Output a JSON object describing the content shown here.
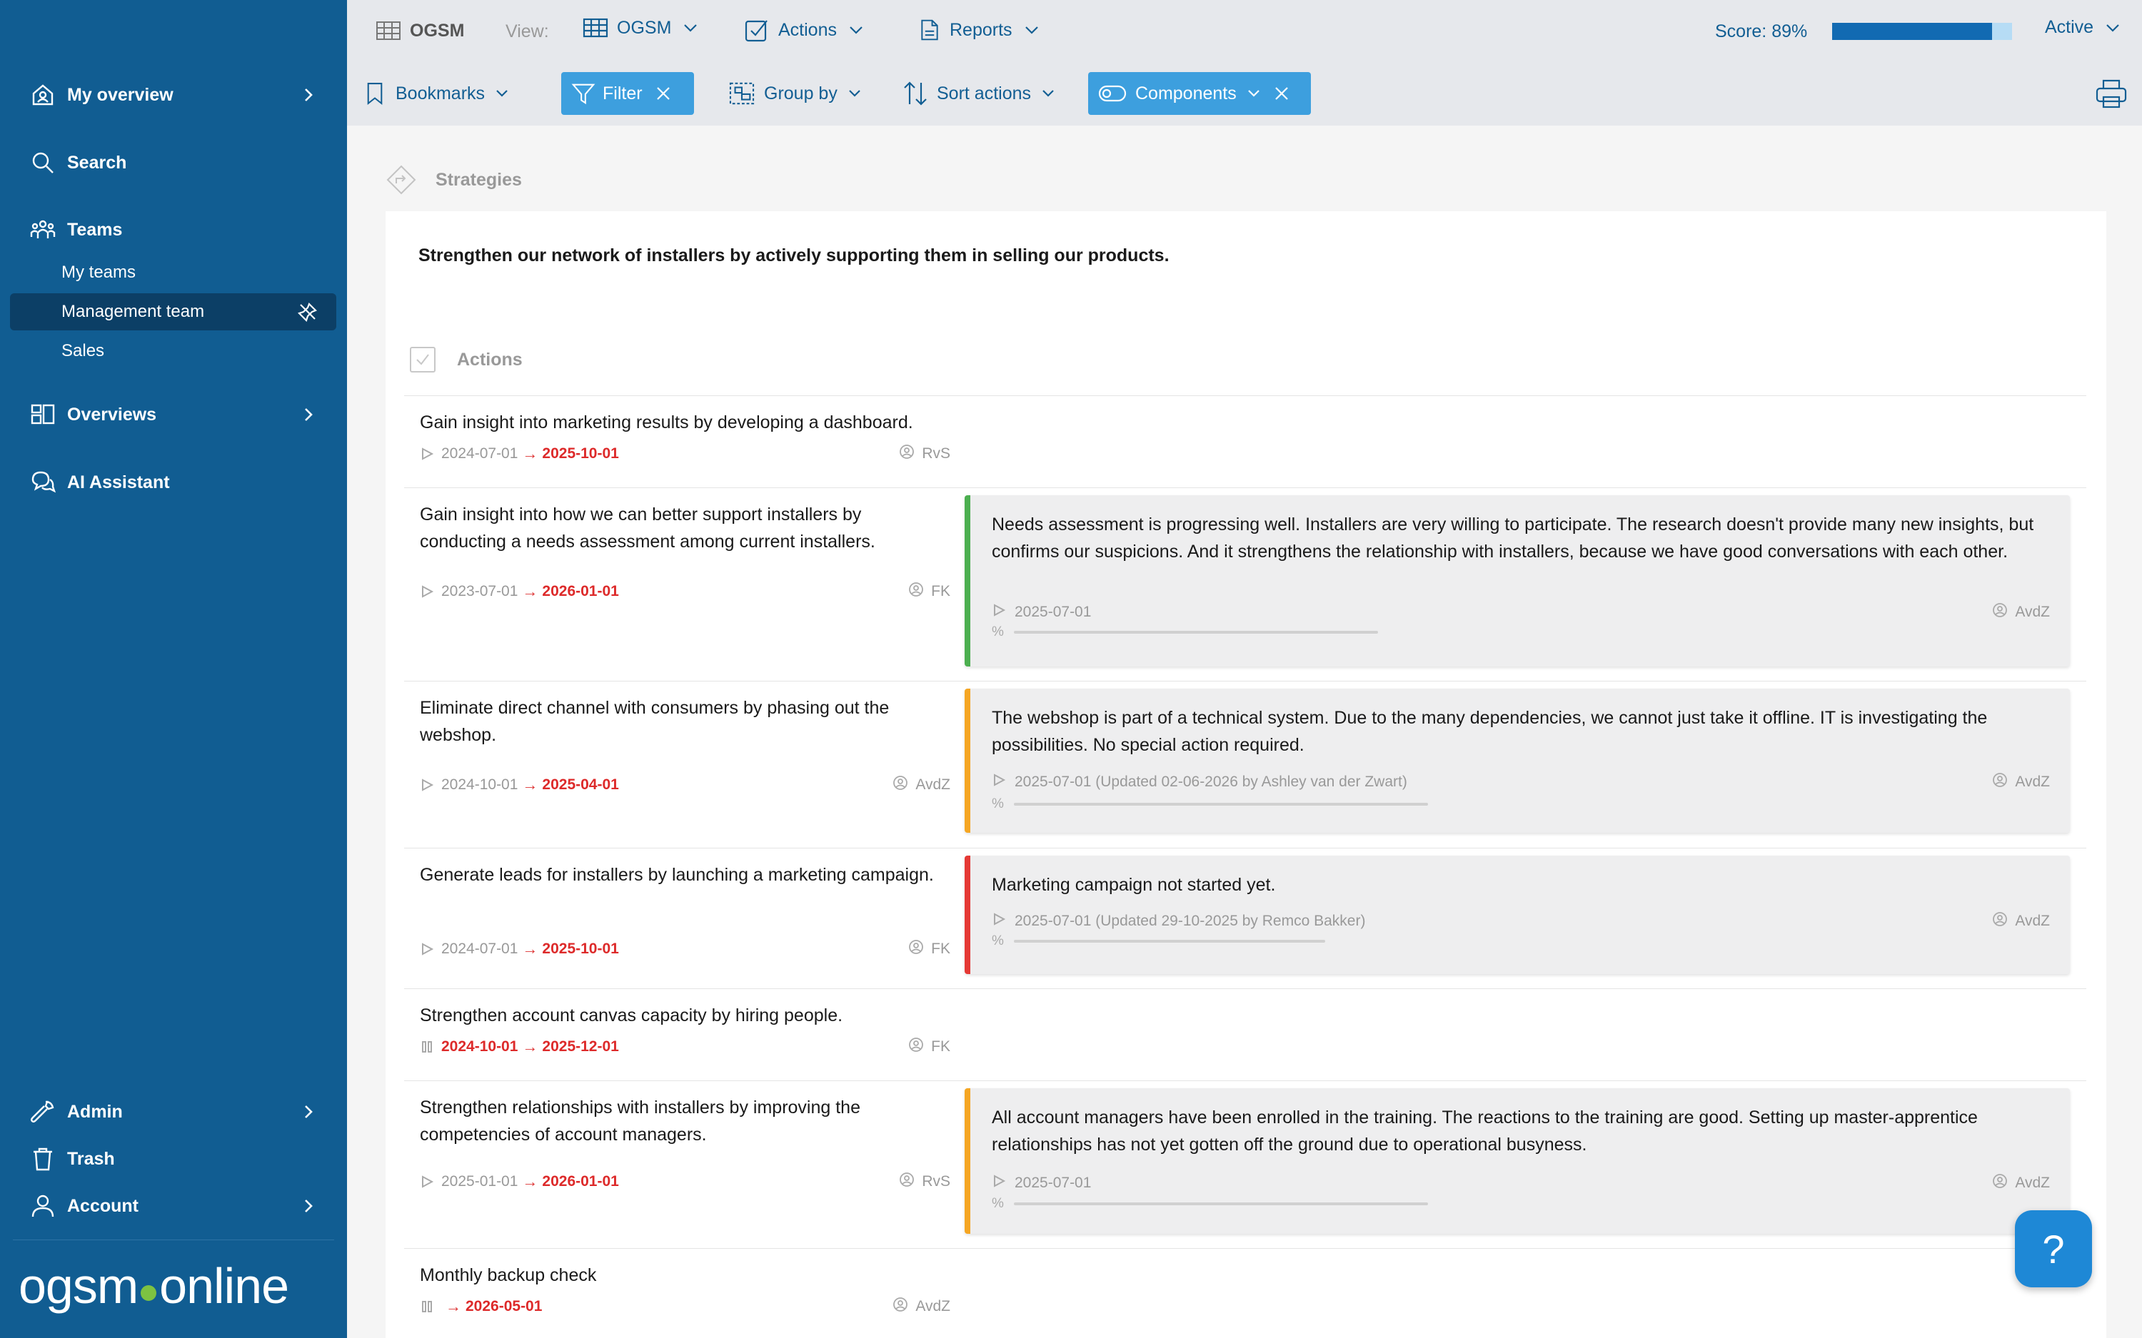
{
  "sidebar": {
    "my_overview": "My overview",
    "search": "Search",
    "teams": "Teams",
    "my_teams": "My teams",
    "management_team": "Management team",
    "sales": "Sales",
    "overviews": "Overviews",
    "ai_assistant": "AI Assistant",
    "admin": "Admin",
    "trash": "Trash",
    "account": "Account",
    "logo_left": "ogsm",
    "logo_right": "online"
  },
  "topbar": {
    "ogsm": "OGSM",
    "view_label": "View:",
    "view_value": "OGSM",
    "actions": "Actions",
    "reports": "Reports",
    "score": "Score: 89%",
    "score_value": 89,
    "status": "Active"
  },
  "toolbar": {
    "bookmarks": "Bookmarks",
    "filter": "Filter",
    "group_by": "Group by",
    "sort_actions": "Sort actions",
    "components": "Components"
  },
  "main": {
    "strategies_label": "Strategies",
    "strategy_text": "Strengthen our network of installers by actively supporting them in selling our products.",
    "actions_label": "Actions",
    "rows": [
      {
        "title": "Gain insight into marketing results by developing a dashboard.",
        "start": "2024-07-01",
        "due": "2025-10-01",
        "owner": "RvS"
      },
      {
        "title": "Gain insight into how we can better support installers by conducting a needs assessment among current installers.",
        "start": "2023-07-01",
        "due": "2026-01-01",
        "owner": "FK",
        "update": {
          "text": "Needs assessment is progressing well. Installers are very willing to participate. The research doesn't provide many new insights, but confirms our suspicions. And it strengthens the relationship with installers, because we have good conversations with each other.",
          "meta": "2025-07-01",
          "owner": "AvdZ",
          "color": "#4caf50"
        }
      },
      {
        "title": "Eliminate direct channel with consumers by phasing out the webshop.",
        "start": "2024-10-01",
        "due": "2025-04-01",
        "owner": "AvdZ",
        "update": {
          "text": "The webshop is part of a technical system. Due to the many dependencies, we cannot just take it offline. IT is investigating the possibilities. No special action required.",
          "meta": "2025-07-01 (Updated 02-06-2026 by Ashley van der Zwart)",
          "owner": "AvdZ",
          "color": "#f5a623"
        }
      },
      {
        "title": "Generate leads for installers by launching a marketing campaign.",
        "start": "2024-07-01",
        "due": "2025-10-01",
        "owner": "FK",
        "update": {
          "text": "Marketing campaign not started yet.",
          "meta": "2025-07-01 (Updated 29-10-2025 by Remco Bakker)",
          "owner": "AvdZ",
          "color": "#e53935"
        }
      },
      {
        "title": "Strengthen account canvas capacity by hiring people.",
        "start": "2024-10-01",
        "due": "2025-12-01",
        "owner": "FK"
      },
      {
        "title": "Strengthen relationships with installers by improving the competencies of account managers.",
        "start": "2025-01-01",
        "due": "2026-01-01",
        "owner": "RvS",
        "update": {
          "text": "All account managers have been enrolled in the training. The reactions to the training are good. Setting up master-apprentice relationships has not yet gotten off the ground due to operational busyness.",
          "meta": "2025-07-01",
          "owner": "AvdZ",
          "color": "#f5a623"
        }
      },
      {
        "title": "Monthly backup check",
        "start": "",
        "due": "2026-05-01",
        "owner": "AvdZ"
      }
    ],
    "percent_symbol": "%"
  },
  "help": "?"
}
